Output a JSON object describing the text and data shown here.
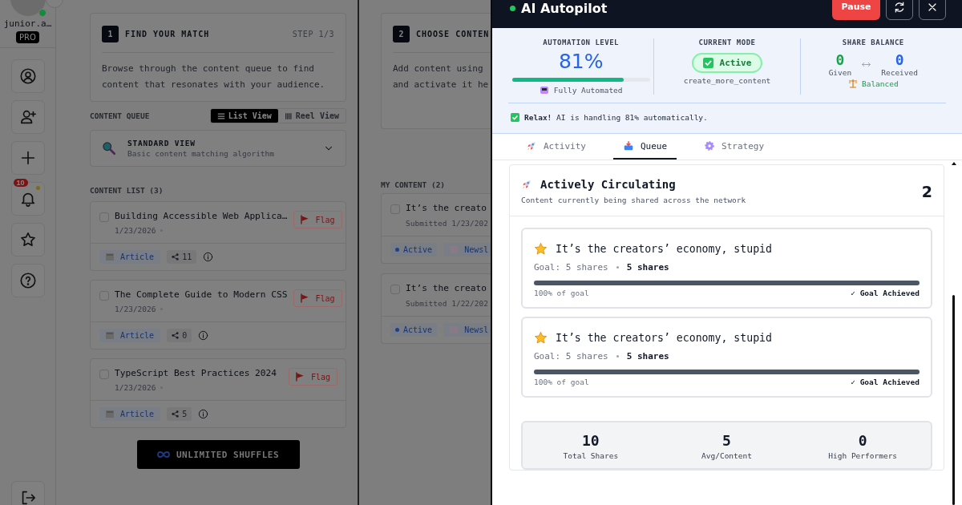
{
  "sidebar": {
    "user": {
      "name": "junior.a…",
      "online": true,
      "badge": "PRO"
    },
    "nav_items": [
      {
        "kind": "profile"
      },
      {
        "kind": "add-user"
      },
      {
        "kind": "create"
      },
      {
        "kind": "notifications",
        "badge": "10"
      },
      {
        "kind": "favorites"
      },
      {
        "kind": "help"
      }
    ],
    "footer_items": [
      {
        "kind": "logout"
      }
    ]
  },
  "step_1": {
    "number": "1",
    "title": "FIND YOUR MATCH",
    "step": "STEP 1/3",
    "text": "Browse through the content queue to find content that resonates with your audience."
  },
  "content_queue": {
    "label": "CONTENT QUEUE",
    "views": [
      {
        "label": "List View",
        "kind": "list",
        "selected": true
      },
      {
        "label": "Reel View",
        "kind": "reel",
        "selected": false
      }
    ],
    "mode_select": {
      "title": "STANDARD VIEW",
      "subtitle": "Basic content matching algorithm"
    }
  },
  "content_list": {
    "title": "CONTENT LIST (3)",
    "items": [
      {
        "title": "Building Accessible Web Applica…",
        "date": "1/23/2026",
        "checked": false,
        "flag": "Flag",
        "type": "Article",
        "shares": "11"
      },
      {
        "title": "The Complete Guide to Modern CSS",
        "date": "1/23/2026",
        "checked": false,
        "flag": "Flag",
        "type": "Article",
        "shares": "0"
      },
      {
        "title": "TypeScript Best Practices 2024",
        "date": "1/23/2026",
        "checked": false,
        "flag": "Flag",
        "type": "Article",
        "shares": "5"
      }
    ]
  },
  "shuffle_button": "UNLIMITED SHUFFLES",
  "step_2": {
    "number": "2",
    "title": "CHOOSE CONTEN",
    "text_lines": [
      "Add content using",
      "and activate it he"
    ]
  },
  "my_content": {
    "title": "MY CONTENT (2)",
    "items": [
      {
        "title": "It’s the creato",
        "submitted": "Submitted 1/23/202",
        "checked": false,
        "status": "Active",
        "type": "Newsl"
      },
      {
        "title": "It’s the creato",
        "submitted": "Submitted 1/22/202",
        "checked": false,
        "status": "Active",
        "type": "Newsl"
      }
    ]
  },
  "autopilot": {
    "title": "AI Autopilot",
    "online": true,
    "pause_button": "Pause",
    "automation": {
      "label": "AUTOMATION LEVEL",
      "value": "81%",
      "level": 0.81,
      "caption": "Fully Automated"
    },
    "mode": {
      "label": "CURRENT MODE",
      "status": "Active",
      "caption": "create_more_content"
    },
    "balance": {
      "label": "SHARE BALANCE",
      "given": "0",
      "given_label": "Given",
      "received": "0",
      "received_label": "Received",
      "status": "Balanced"
    },
    "notice": "**Relax!** AI is handling 81% automatically.",
    "tabs": [
      {
        "label": "Activity",
        "kind": "rocket",
        "selected": false
      },
      {
        "label": "Queue",
        "kind": "inbox",
        "selected": true
      },
      {
        "label": "Strategy",
        "kind": "gear",
        "selected": false
      }
    ],
    "section": {
      "title": "Actively Circulating",
      "subtitle": "Content currently being shared across the network",
      "count": "2",
      "items": [
        {
          "title": "It’s the creators’ economy, stupid",
          "goal": "Goal: 5 shares",
          "current": "5 shares",
          "level": 1,
          "progress_label": "100% of goal",
          "status": "✓ Goal Achieved"
        },
        {
          "title": "It’s the creators’ economy, stupid",
          "goal": "Goal: 5 shares",
          "current": "5 shares",
          "level": 1,
          "progress_label": "100% of goal",
          "status": "✓ Goal Achieved"
        }
      ]
    },
    "summary": [
      {
        "value": "10",
        "label": "Total Shares"
      },
      {
        "value": "5",
        "label": "Avg/Content"
      },
      {
        "value": "0",
        "label": "High Performers"
      }
    ]
  }
}
